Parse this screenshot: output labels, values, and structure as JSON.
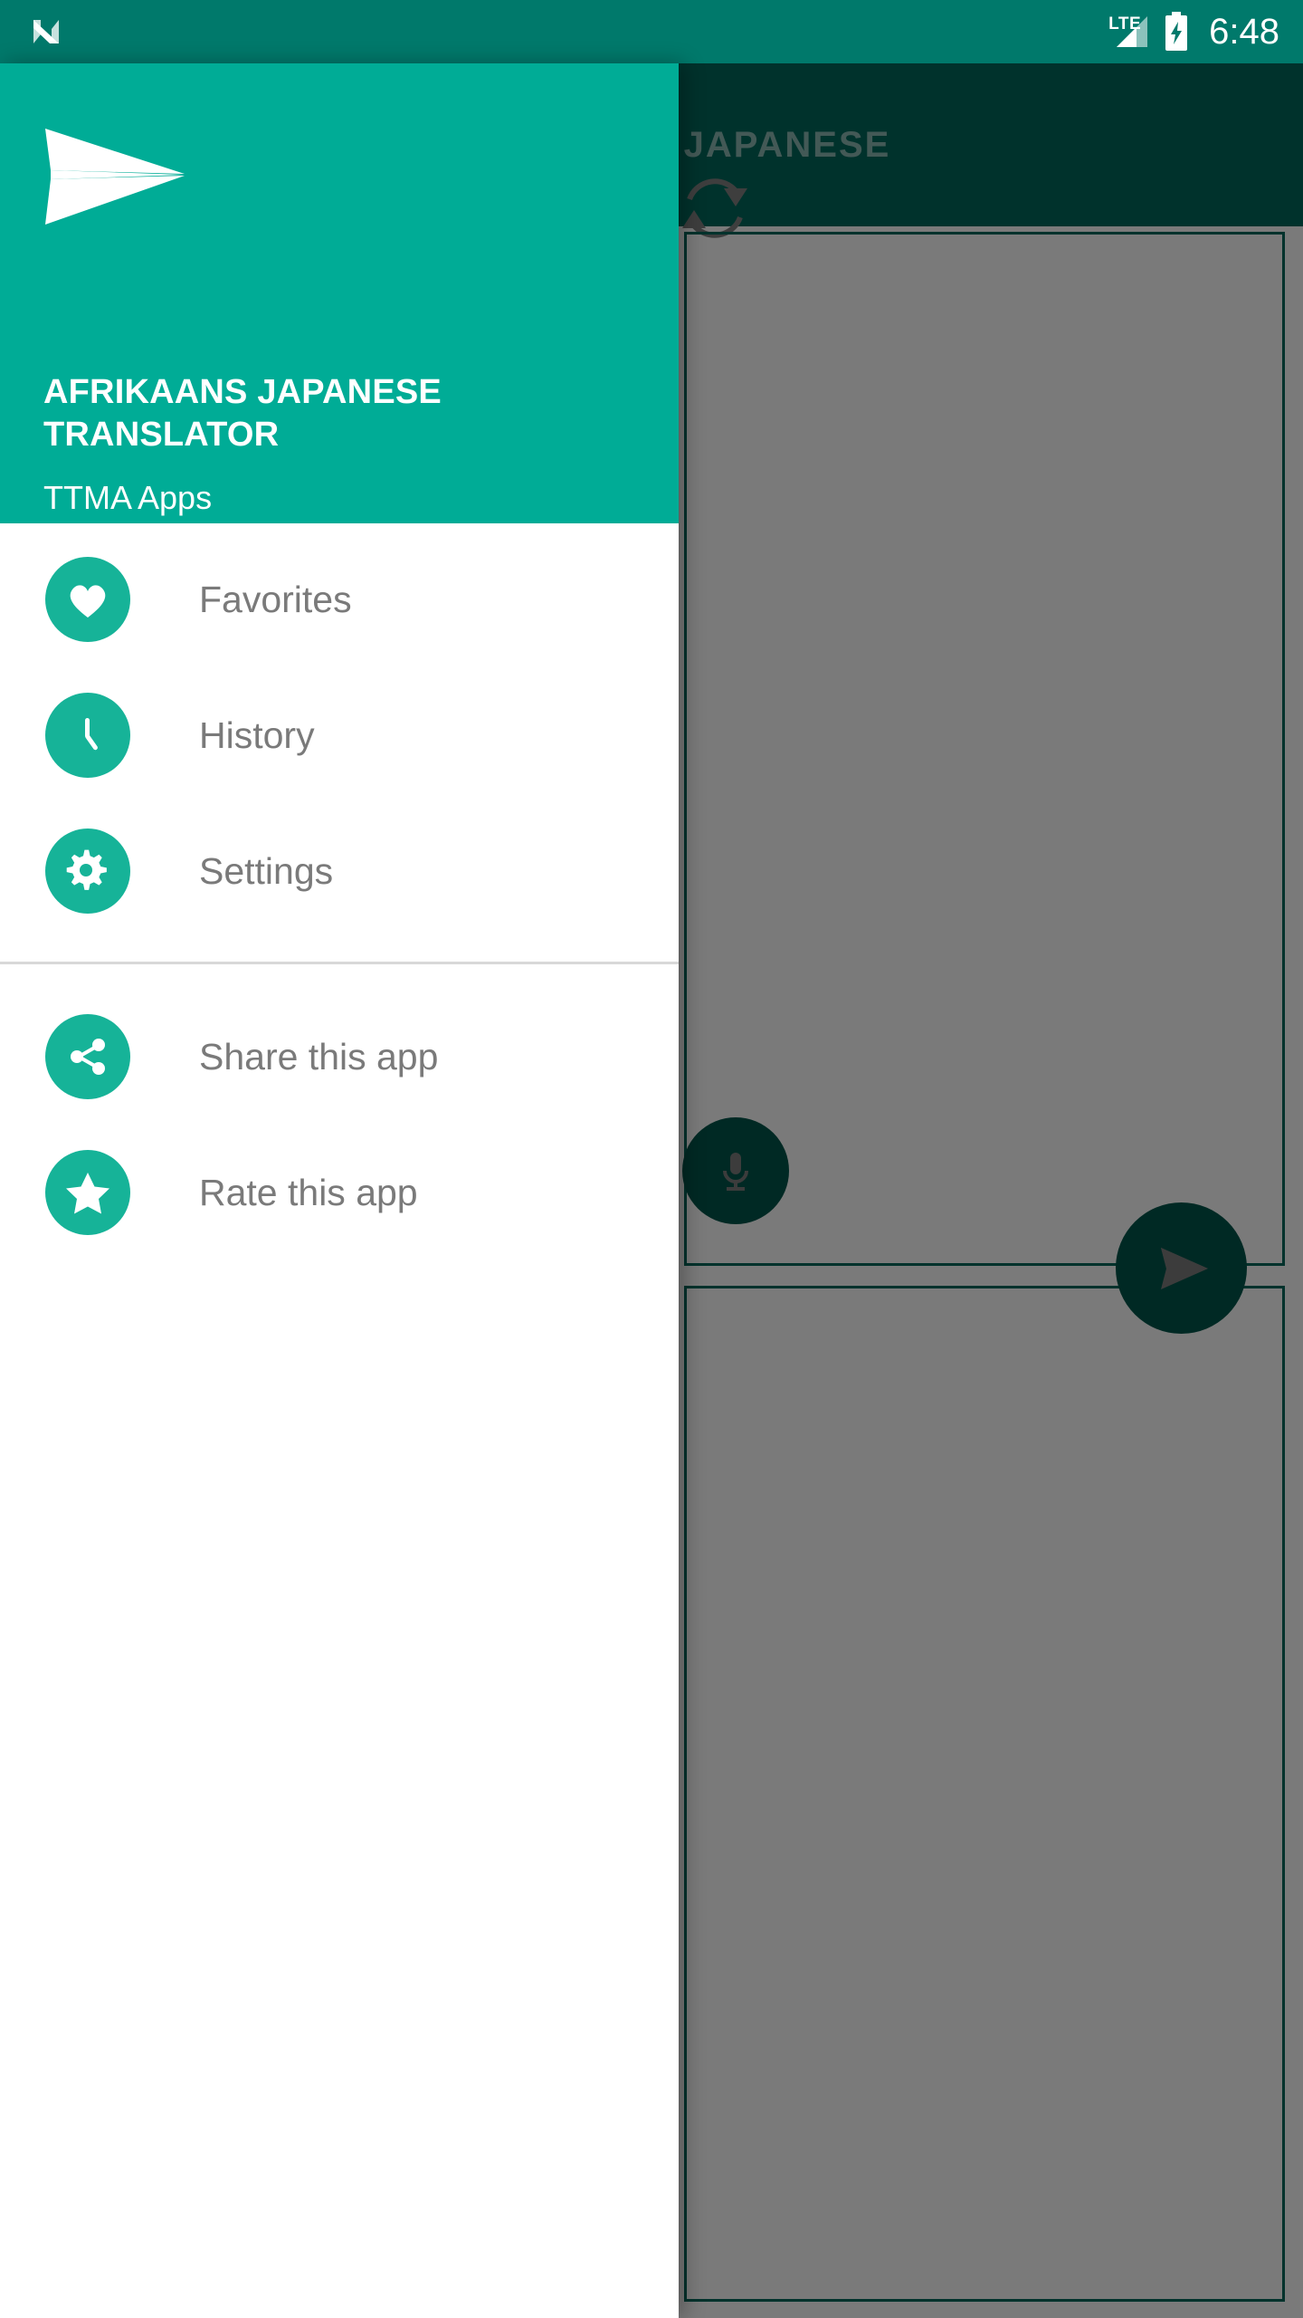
{
  "status_bar": {
    "notification_icon": "android-n-logo-icon",
    "network_label": "LTE",
    "signal_icon": "signal-bars-icon",
    "battery_icon": "battery-charging-icon",
    "clock": "6:48"
  },
  "toolbar": {
    "swap_icon": "swap-languages-icon",
    "language_label": "JAPANESE"
  },
  "translation_screen": {
    "source_card_name": "source-text-card",
    "target_card_name": "target-text-card",
    "mic_icon": "microphone-icon",
    "send_icon": "send-translate-icon"
  },
  "drawer": {
    "logo_icon": "paper-plane-logo-icon",
    "title": "AFRIKAANS JAPANESE TRANSLATOR",
    "subtitle": "TTMA Apps",
    "header_color": "#00AC96",
    "icon_color": "#16B398",
    "label_color": "#7A7A7A",
    "primary_items": [
      {
        "label": "Favorites",
        "icon": "heart-icon",
        "name": "sidebar-item-favorites"
      },
      {
        "label": "History",
        "icon": "clock-icon",
        "name": "sidebar-item-history"
      },
      {
        "label": "Settings",
        "icon": "gear-icon",
        "name": "sidebar-item-settings"
      }
    ],
    "secondary_items": [
      {
        "label": "Share this app",
        "icon": "share-icon",
        "name": "sidebar-item-share-app"
      },
      {
        "label": "Rate this app",
        "icon": "star-icon",
        "name": "sidebar-item-rate-app"
      }
    ]
  },
  "colors": {
    "status_bar": "#00796B",
    "toolbar": "#00695C",
    "accent": "#00AC96",
    "fab": "#00574B",
    "scrim": "rgba(0,0,0,0.52)"
  }
}
